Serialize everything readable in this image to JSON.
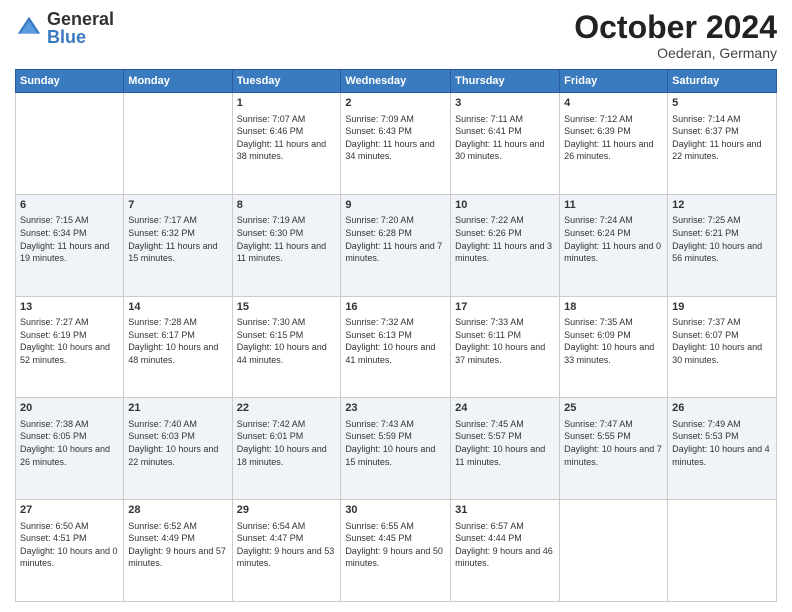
{
  "header": {
    "logo_general": "General",
    "logo_blue": "Blue",
    "month_title": "October 2024",
    "location": "Oederan, Germany"
  },
  "days_of_week": [
    "Sunday",
    "Monday",
    "Tuesday",
    "Wednesday",
    "Thursday",
    "Friday",
    "Saturday"
  ],
  "weeks": [
    [
      {
        "day": "",
        "info": ""
      },
      {
        "day": "",
        "info": ""
      },
      {
        "day": "1",
        "info": "Sunrise: 7:07 AM\nSunset: 6:46 PM\nDaylight: 11 hours and 38 minutes."
      },
      {
        "day": "2",
        "info": "Sunrise: 7:09 AM\nSunset: 6:43 PM\nDaylight: 11 hours and 34 minutes."
      },
      {
        "day": "3",
        "info": "Sunrise: 7:11 AM\nSunset: 6:41 PM\nDaylight: 11 hours and 30 minutes."
      },
      {
        "day": "4",
        "info": "Sunrise: 7:12 AM\nSunset: 6:39 PM\nDaylight: 11 hours and 26 minutes."
      },
      {
        "day": "5",
        "info": "Sunrise: 7:14 AM\nSunset: 6:37 PM\nDaylight: 11 hours and 22 minutes."
      }
    ],
    [
      {
        "day": "6",
        "info": "Sunrise: 7:15 AM\nSunset: 6:34 PM\nDaylight: 11 hours and 19 minutes."
      },
      {
        "day": "7",
        "info": "Sunrise: 7:17 AM\nSunset: 6:32 PM\nDaylight: 11 hours and 15 minutes."
      },
      {
        "day": "8",
        "info": "Sunrise: 7:19 AM\nSunset: 6:30 PM\nDaylight: 11 hours and 11 minutes."
      },
      {
        "day": "9",
        "info": "Sunrise: 7:20 AM\nSunset: 6:28 PM\nDaylight: 11 hours and 7 minutes."
      },
      {
        "day": "10",
        "info": "Sunrise: 7:22 AM\nSunset: 6:26 PM\nDaylight: 11 hours and 3 minutes."
      },
      {
        "day": "11",
        "info": "Sunrise: 7:24 AM\nSunset: 6:24 PM\nDaylight: 11 hours and 0 minutes."
      },
      {
        "day": "12",
        "info": "Sunrise: 7:25 AM\nSunset: 6:21 PM\nDaylight: 10 hours and 56 minutes."
      }
    ],
    [
      {
        "day": "13",
        "info": "Sunrise: 7:27 AM\nSunset: 6:19 PM\nDaylight: 10 hours and 52 minutes."
      },
      {
        "day": "14",
        "info": "Sunrise: 7:28 AM\nSunset: 6:17 PM\nDaylight: 10 hours and 48 minutes."
      },
      {
        "day": "15",
        "info": "Sunrise: 7:30 AM\nSunset: 6:15 PM\nDaylight: 10 hours and 44 minutes."
      },
      {
        "day": "16",
        "info": "Sunrise: 7:32 AM\nSunset: 6:13 PM\nDaylight: 10 hours and 41 minutes."
      },
      {
        "day": "17",
        "info": "Sunrise: 7:33 AM\nSunset: 6:11 PM\nDaylight: 10 hours and 37 minutes."
      },
      {
        "day": "18",
        "info": "Sunrise: 7:35 AM\nSunset: 6:09 PM\nDaylight: 10 hours and 33 minutes."
      },
      {
        "day": "19",
        "info": "Sunrise: 7:37 AM\nSunset: 6:07 PM\nDaylight: 10 hours and 30 minutes."
      }
    ],
    [
      {
        "day": "20",
        "info": "Sunrise: 7:38 AM\nSunset: 6:05 PM\nDaylight: 10 hours and 26 minutes."
      },
      {
        "day": "21",
        "info": "Sunrise: 7:40 AM\nSunset: 6:03 PM\nDaylight: 10 hours and 22 minutes."
      },
      {
        "day": "22",
        "info": "Sunrise: 7:42 AM\nSunset: 6:01 PM\nDaylight: 10 hours and 18 minutes."
      },
      {
        "day": "23",
        "info": "Sunrise: 7:43 AM\nSunset: 5:59 PM\nDaylight: 10 hours and 15 minutes."
      },
      {
        "day": "24",
        "info": "Sunrise: 7:45 AM\nSunset: 5:57 PM\nDaylight: 10 hours and 11 minutes."
      },
      {
        "day": "25",
        "info": "Sunrise: 7:47 AM\nSunset: 5:55 PM\nDaylight: 10 hours and 7 minutes."
      },
      {
        "day": "26",
        "info": "Sunrise: 7:49 AM\nSunset: 5:53 PM\nDaylight: 10 hours and 4 minutes."
      }
    ],
    [
      {
        "day": "27",
        "info": "Sunrise: 6:50 AM\nSunset: 4:51 PM\nDaylight: 10 hours and 0 minutes."
      },
      {
        "day": "28",
        "info": "Sunrise: 6:52 AM\nSunset: 4:49 PM\nDaylight: 9 hours and 57 minutes."
      },
      {
        "day": "29",
        "info": "Sunrise: 6:54 AM\nSunset: 4:47 PM\nDaylight: 9 hours and 53 minutes."
      },
      {
        "day": "30",
        "info": "Sunrise: 6:55 AM\nSunset: 4:45 PM\nDaylight: 9 hours and 50 minutes."
      },
      {
        "day": "31",
        "info": "Sunrise: 6:57 AM\nSunset: 4:44 PM\nDaylight: 9 hours and 46 minutes."
      },
      {
        "day": "",
        "info": ""
      },
      {
        "day": "",
        "info": ""
      }
    ]
  ]
}
